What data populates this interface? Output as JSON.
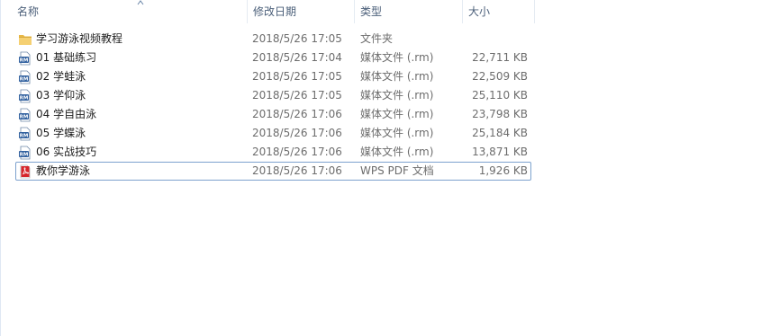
{
  "columns": {
    "name": "名称",
    "date": "修改日期",
    "type": "类型",
    "size": "大小"
  },
  "files": [
    {
      "name": "学习游泳视频教程",
      "date": "2018/5/26 17:05",
      "type": "文件夹",
      "size": "",
      "icon": "folder-icon"
    },
    {
      "name": "01 基础练习",
      "date": "2018/5/26 17:04",
      "type": "媒体文件 (.rm)",
      "size": "22,711 KB",
      "icon": "rm-file-icon"
    },
    {
      "name": "02 学蛙泳",
      "date": "2018/5/26 17:05",
      "type": "媒体文件 (.rm)",
      "size": "22,509 KB",
      "icon": "rm-file-icon"
    },
    {
      "name": "03 学仰泳",
      "date": "2018/5/26 17:05",
      "type": "媒体文件 (.rm)",
      "size": "25,110 KB",
      "icon": "rm-file-icon"
    },
    {
      "name": "04 学自由泳",
      "date": "2018/5/26 17:06",
      "type": "媒体文件 (.rm)",
      "size": "23,798 KB",
      "icon": "rm-file-icon"
    },
    {
      "name": "05 学蝶泳",
      "date": "2018/5/26 17:06",
      "type": "媒体文件 (.rm)",
      "size": "25,184 KB",
      "icon": "rm-file-icon"
    },
    {
      "name": "06 实战技巧",
      "date": "2018/5/26 17:06",
      "type": "媒体文件 (.rm)",
      "size": "13,871 KB",
      "icon": "rm-file-icon"
    },
    {
      "name": "教你学游泳",
      "date": "2018/5/26 17:06",
      "type": "WPS PDF 文档",
      "size": "1,926 KB",
      "icon": "pdf-file-icon",
      "selected": true
    }
  ],
  "colors": {
    "header_text": "#4c607a",
    "selection_border": "#7da2ce",
    "folder": "#e8b846",
    "rm_icon": "#2f5f9e",
    "pdf_icon": "#d6262b"
  }
}
